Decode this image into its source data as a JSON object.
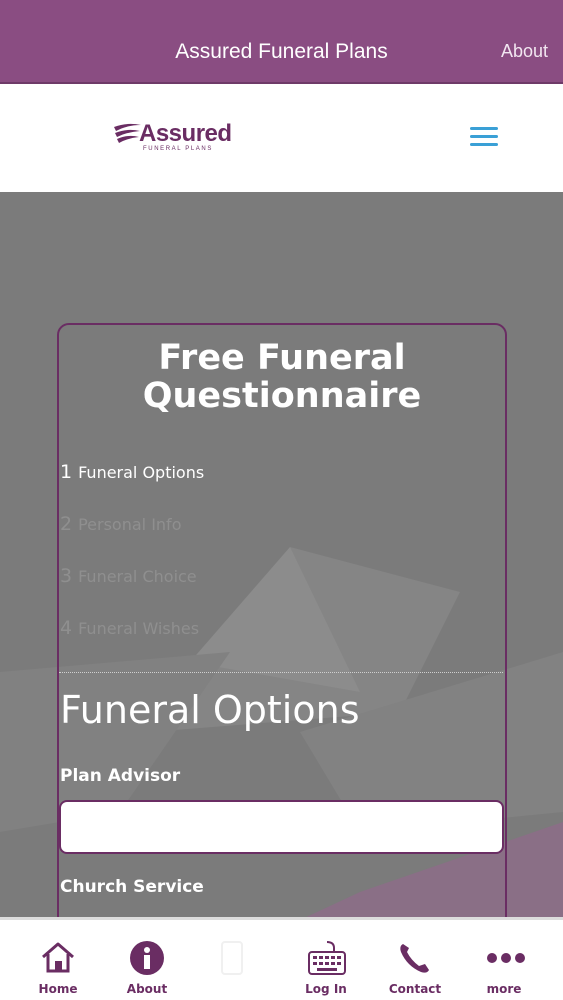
{
  "topbar": {
    "title": "Assured Funeral Plans",
    "about_link": "About"
  },
  "logo": {
    "word": "Assured",
    "tagline": "FUNERAL PLANS"
  },
  "form": {
    "title": "Free Funeral Questionnaire",
    "steps": [
      {
        "num": "1",
        "label": "Funeral Options"
      },
      {
        "num": "2",
        "label": "Personal Info"
      },
      {
        "num": "3",
        "label": "Funeral Choice"
      },
      {
        "num": "4",
        "label": "Funeral Wishes"
      }
    ],
    "section_title": "Funeral Options",
    "plan_advisor_label": "Plan Advisor",
    "plan_advisor_value": "",
    "church_service_label": "Church Service"
  },
  "tabs": [
    {
      "label": "Home",
      "icon": "home-icon"
    },
    {
      "label": "About",
      "icon": "info-icon"
    },
    {
      "label": "",
      "icon": "phone-device-icon"
    },
    {
      "label": "Log In",
      "icon": "keyboard-icon"
    },
    {
      "label": "Contact",
      "icon": "telephone-icon"
    },
    {
      "label": "more",
      "icon": "more-icon"
    }
  ],
  "colors": {
    "brand_purple": "#8a4d82",
    "dark_purple": "#6a2d63",
    "menu_blue": "#3aa0d6"
  }
}
